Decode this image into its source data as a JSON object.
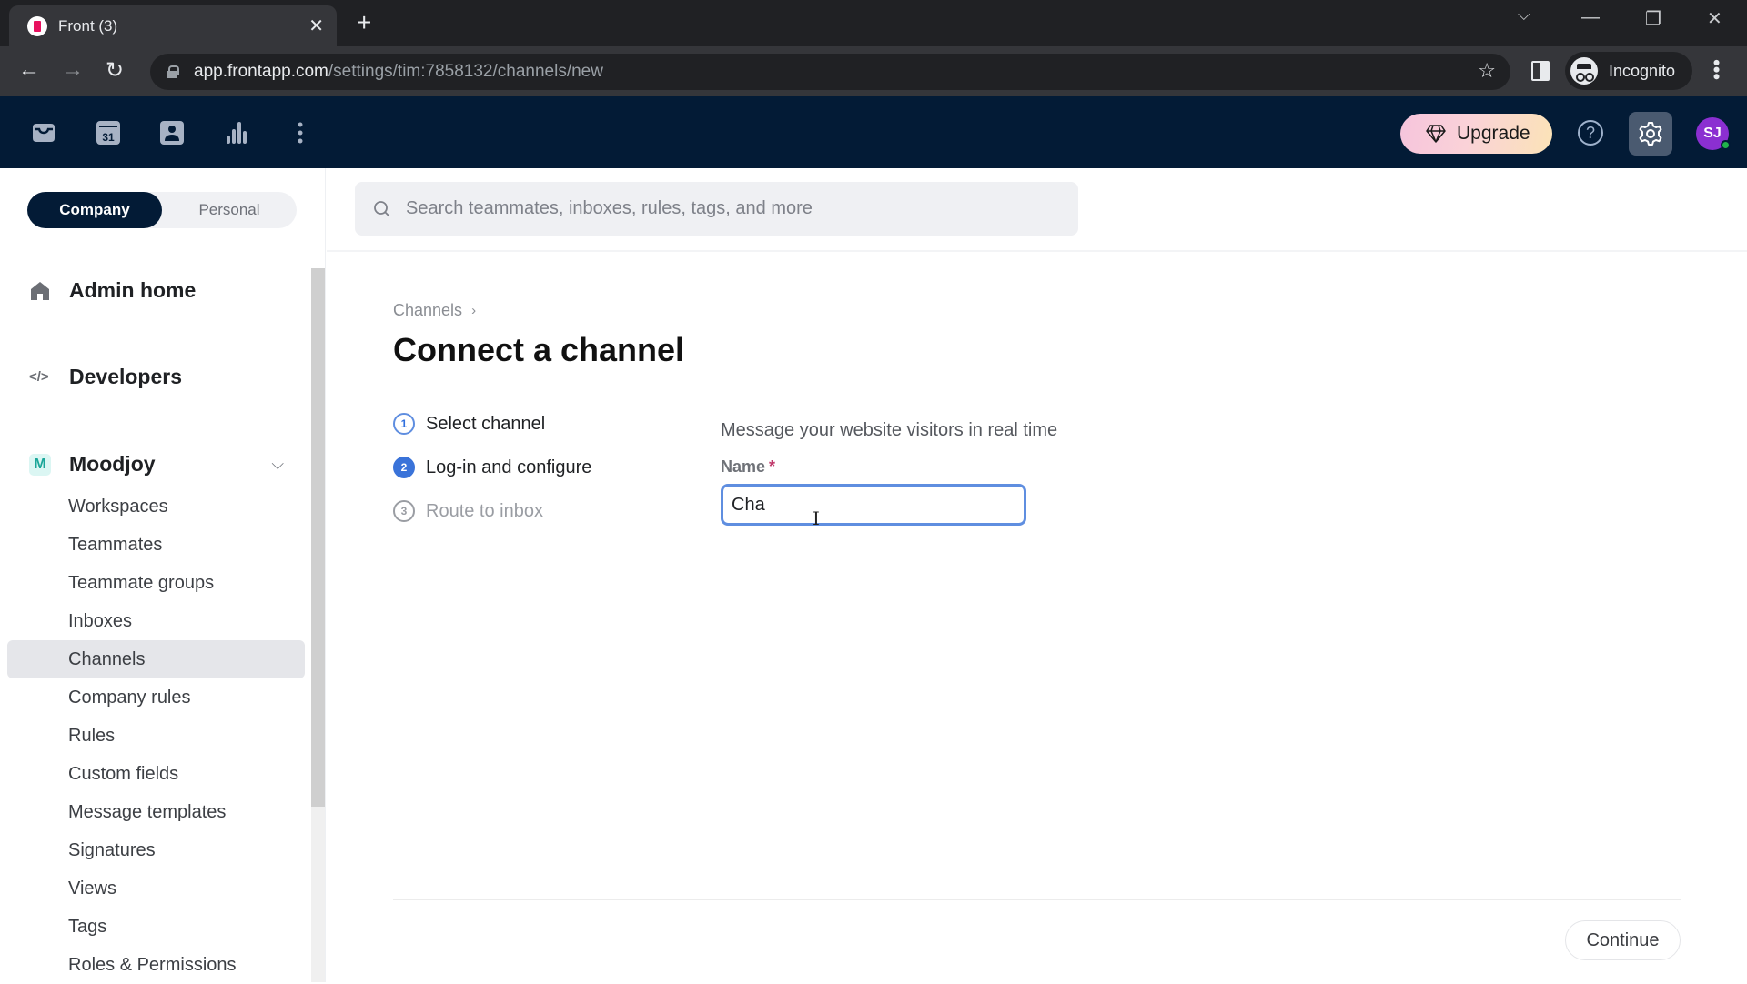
{
  "browser": {
    "tab_title": "Front (3)",
    "url_host": "app.frontapp.com",
    "url_path": "/settings/tim:7858132/channels/new",
    "profile_label": "Incognito"
  },
  "header": {
    "nav_icons": [
      "inbox-icon",
      "calendar-icon",
      "contacts-icon",
      "analytics-icon",
      "more-icon"
    ],
    "calendar_day": "31",
    "upgrade_label": "Upgrade",
    "help_glyph": "?",
    "avatar_initials": "SJ",
    "colors": {
      "header_bg": "#031b36",
      "avatar_bg": "#8b2fd1",
      "status_online": "#21b24b"
    }
  },
  "sidebar": {
    "scope_tabs": [
      {
        "label": "Company",
        "active": true
      },
      {
        "label": "Personal",
        "active": false
      }
    ],
    "top_links": [
      {
        "label": "Admin home",
        "icon": "home-icon"
      },
      {
        "label": "Developers",
        "icon": "code-icon"
      }
    ],
    "org": {
      "badge": "M",
      "name": "Moodjoy"
    },
    "items": [
      {
        "label": "Workspaces"
      },
      {
        "label": "Teammates"
      },
      {
        "label": "Teammate groups"
      },
      {
        "label": "Inboxes"
      },
      {
        "label": "Channels",
        "active": true
      },
      {
        "label": "Company rules"
      },
      {
        "label": "Rules"
      },
      {
        "label": "Custom fields"
      },
      {
        "label": "Message templates"
      },
      {
        "label": "Signatures"
      },
      {
        "label": "Views"
      },
      {
        "label": "Tags"
      },
      {
        "label": "Roles & Permissions"
      }
    ]
  },
  "search": {
    "placeholder": "Search teammates, inboxes, rules, tags, and more",
    "value": ""
  },
  "main": {
    "breadcrumb": "Channels",
    "breadcrumb_sep": "›",
    "title": "Connect a channel",
    "steps": [
      {
        "num": "1",
        "label": "Select channel",
        "state": "done"
      },
      {
        "num": "2",
        "label": "Log-in and configure",
        "state": "current"
      },
      {
        "num": "3",
        "label": "Route to inbox",
        "state": "todo"
      }
    ],
    "form": {
      "description": "Message your website visitors in real time",
      "name_label": "Name",
      "required_mark": "*",
      "name_value": "Cha"
    },
    "continue_label": "Continue",
    "accent_color": "#3a73d9"
  }
}
